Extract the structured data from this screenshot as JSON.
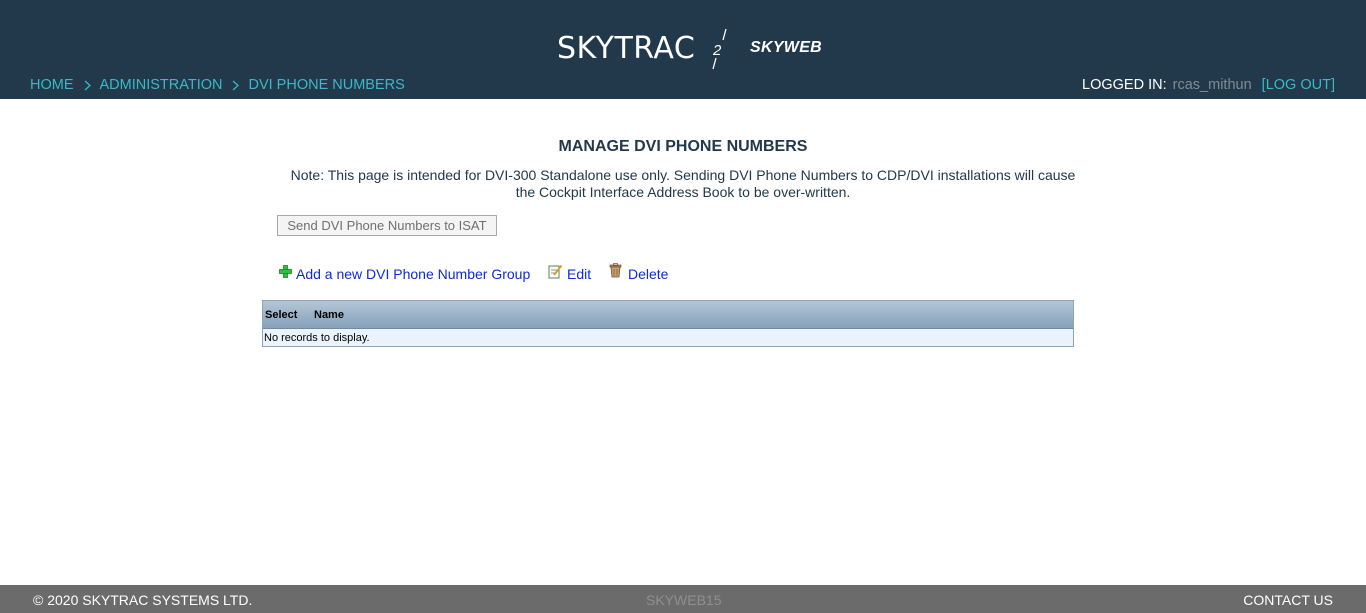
{
  "header": {
    "logo": "SKYTRAC",
    "logo_mark": "2",
    "product": "SKYWEB",
    "breadcrumbs": [
      "HOME",
      "ADMINISTRATION",
      "DVI PHONE NUMBERS"
    ],
    "login_label": "LOGGED IN:",
    "username": "rcas_mithun",
    "logout_label": "[LOG OUT]"
  },
  "main": {
    "title": "MANAGE DVI PHONE NUMBERS",
    "note_line1": "Note: This page is intended for DVI-300 Standalone use only. Sending DVI Phone Numbers to CDP/DVI installations will cause",
    "note_line2": "the Cockpit Interface Address Book to be over-written.",
    "send_button": "Send DVI Phone Numbers to ISAT",
    "actions": {
      "add": "Add a new DVI Phone Number Group",
      "edit": "Edit",
      "delete": "Delete"
    },
    "grid": {
      "columns": [
        "Select",
        "Name"
      ],
      "empty_message": "No records to display."
    }
  },
  "footer": {
    "copyright": "© 2020 SKYTRAC SYSTEMS LTD.",
    "version": "SKYWEB15",
    "contact": "CONTACT US"
  },
  "colors": {
    "header_bg": "#21394a",
    "link_teal": "#3bb8c9",
    "action_link": "#0e2bd6",
    "footer_bg": "#6b6b6b"
  }
}
